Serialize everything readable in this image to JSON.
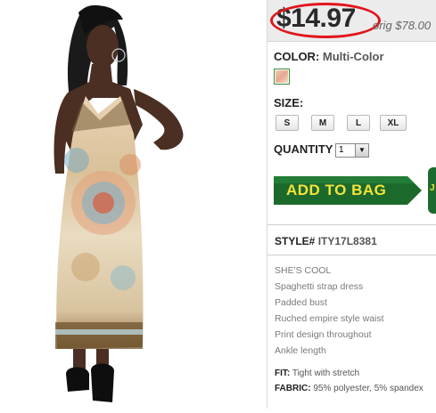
{
  "product": {
    "price": "$14.97",
    "orig_price": "orig $78.00"
  },
  "color": {
    "label": "COLOR:",
    "value": "Multi-Color"
  },
  "size": {
    "label": "SIZE:",
    "options": [
      "S",
      "M",
      "L",
      "XL"
    ]
  },
  "quantity": {
    "label": "QUANTITY",
    "value": "1"
  },
  "cart": {
    "add_label": "ADD TO BAG",
    "side_letter": "J"
  },
  "style": {
    "label": "STYLE#",
    "value": "ITY17L8381"
  },
  "description": {
    "features": [
      "SHE'S COOL",
      "Spaghetti strap dress",
      "Padded bust",
      "Ruched empire style waist",
      "Print design throughout",
      "Ankle length"
    ],
    "fit_label": "FIT:",
    "fit_value": "Tight with stretch",
    "fabric_label": "FABRIC:",
    "fabric_value": "95% polyester, 5% spandex"
  },
  "colors": {
    "price_circle": "#e2151b",
    "add_button": "#1b6a2c",
    "add_text": "#f5e23a"
  }
}
